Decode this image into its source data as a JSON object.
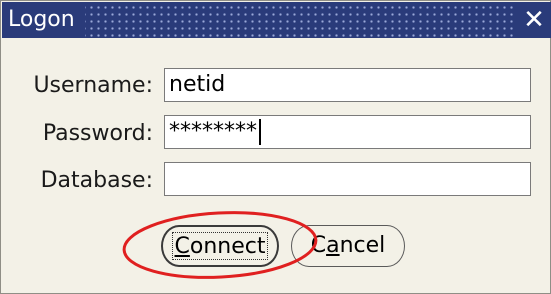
{
  "window": {
    "title": "Logon",
    "close_glyph": "✕",
    "close_icon": "close-icon"
  },
  "form": {
    "username": {
      "label": "Username:",
      "value": "netid"
    },
    "password": {
      "label": "Password:",
      "value": "********"
    },
    "database": {
      "label": "Database:",
      "value": ""
    }
  },
  "buttons": {
    "connect": {
      "mnemonic": "C",
      "rest": "onnect",
      "full": "Connect"
    },
    "cancel": {
      "prefix": "C",
      "mnemonic": "a",
      "rest": "ncel",
      "full": "Cancel"
    }
  },
  "colors": {
    "titlebar": "#2a3b7a",
    "dialog_bg": "#f3f1e7",
    "highlight_circle": "#e02020"
  }
}
